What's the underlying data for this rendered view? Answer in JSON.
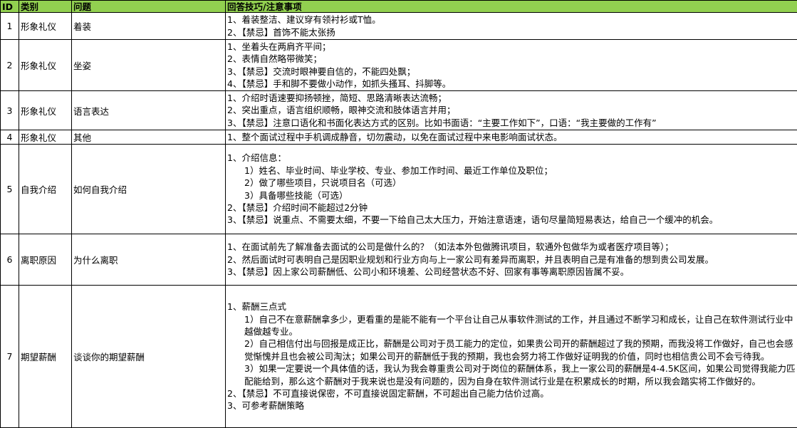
{
  "headers": {
    "id": "ID",
    "category": "类别",
    "question": "问题",
    "answer": "回答技巧/注意事项"
  },
  "rows": [
    {
      "id": "1",
      "category": "形象礼仪",
      "question": "着装",
      "answer": [
        {
          "text": "1、着装整洁、建议穿有领衬衫或T恤。",
          "indent": false
        },
        {
          "text": "2、【禁忌】首饰不能太张扬",
          "indent": false
        }
      ]
    },
    {
      "id": "2",
      "category": "形象礼仪",
      "question": "坐姿",
      "answer": [
        {
          "text": "1、坐着头在两肩齐平间；",
          "indent": false
        },
        {
          "text": "2、表情自然略带微笑；",
          "indent": false
        },
        {
          "text": "3、【禁忌】交流时眼神要自信的，不能四处飘；",
          "indent": false
        },
        {
          "text": "4、【禁忌】手和脚不要做小动作，如抓头搔耳、抖脚等。",
          "indent": false
        }
      ]
    },
    {
      "id": "3",
      "category": "形象礼仪",
      "question": "语言表达",
      "answer": [
        {
          "text": "1、介绍时语速要抑扬顿挫，简短、思路清晰表达流畅；",
          "indent": false
        },
        {
          "text": "2、突出重点，语言组织顺畅，眼神交流和肢体语言并用；",
          "indent": false
        },
        {
          "text": "3、【禁忌】注意口语化和书面化表达方式的区别。比如书面语：“主要工作如下”，口语：“我主要做的工作有”",
          "indent": false
        }
      ]
    },
    {
      "id": "4",
      "category": "形象礼仪",
      "question": "其他",
      "answer": [
        {
          "text": "1、整个面试过程中手机调成静音，切勿震动，以免在面试过程中来电影响面试状态。",
          "indent": false
        }
      ]
    },
    {
      "id": "5",
      "category": "自我介绍",
      "question": "如何自我介绍",
      "answer": [
        {
          "text": "1、介绍信息：",
          "indent": false
        },
        {
          "text": "1）姓名、毕业时间、毕业学校、专业、参加工作时间、最近工作单位及职位；",
          "indent": true
        },
        {
          "text": "2）做了哪些项目，只说项目名（可选）",
          "indent": true
        },
        {
          "text": "3）具备哪些技能（可选）",
          "indent": true
        },
        {
          "text": "2、【禁忌】介绍时间不能超过2分钟",
          "indent": false
        },
        {
          "text": "3、【禁忌】说重点、不需要太细，不要一下给自己太大压力，开始注意语速，语句尽量简短易表达，给自己一个缓冲的机会。",
          "indent": false
        }
      ]
    },
    {
      "id": "6",
      "category": "离职原因",
      "question": "为什么离职",
      "answer": [
        {
          "text": "1、在面试前先了解准备去面试的公司是做什么的？（如法本外包做腾讯项目，软通外包做华为或者医疗项目等）；",
          "indent": false
        },
        {
          "text": "2、然后面试时可表明自己是因职业规划和行业方向与上一家公司有差异而离职，并且表明自己是有准备的想到贵公司发展。",
          "indent": false
        },
        {
          "text": "3、【禁忌】因上家公司薪酬低、公司小和环境差、公司经营状态不好、回家有事等离职原因皆属不妥。",
          "indent": false
        }
      ]
    },
    {
      "id": "7",
      "category": "期望薪酬",
      "question": "谈谈你的期望薪酬",
      "answer": [
        {
          "text": "1、薪酬三点式",
          "indent": false
        },
        {
          "text": "1）自己不在意薪酬拿多少，更看重的是能不能有一个平台让自己从事软件测试的工作，并且通过不断学习和成长，让自己在软件测试行业中越做越专业。",
          "indent": true
        },
        {
          "text": "2）自己相信付出与回报是成正比，薪酬是公司对于员工能力的定位，如果贵公司开的薪酬超过了我的预期，而我没将工作做好，自己也会感觉惭愧并且也会被公司淘汰；如果公司开的薪酬低于我的预期，我也会努力将工作做好证明我的价值，同时也相信贵公司不会亏待我。",
          "indent": true
        },
        {
          "text": "3）如果一定要说一个具体值的话，我认为我会尊重贵公司对于岗位的薪酬体系，我上一家公司的薪酬是4-4.5K区间，如果公司觉得我能力匹配能给到，那么这个薪酬对于我来说也是没有问题的，因为自身在软件测试行业是在积累成长的时期，所以我会踏实将工作做好的。",
          "indent": true
        },
        {
          "text": "2、【禁忌】不可直接说保密，不可直接说固定薪酬，不可超出自己能力估价过高。",
          "indent": false
        },
        {
          "text": "3、可参考薪酬策略",
          "indent": false
        }
      ]
    }
  ],
  "colors": {
    "header_bg": "#92d050",
    "grid": "#000000"
  }
}
